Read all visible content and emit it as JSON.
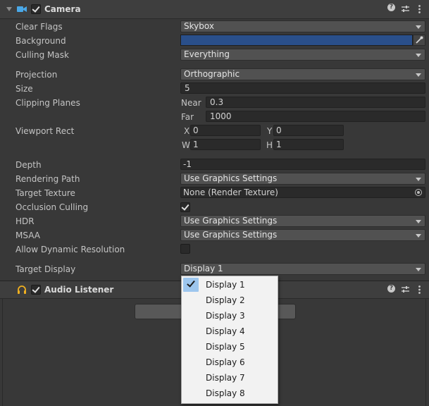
{
  "camera": {
    "title": "Camera",
    "clear_flags": {
      "label": "Clear Flags",
      "value": "Skybox"
    },
    "background": {
      "label": "Background",
      "color": "#2a4f8a"
    },
    "culling_mask": {
      "label": "Culling Mask",
      "value": "Everything"
    },
    "projection": {
      "label": "Projection",
      "value": "Orthographic"
    },
    "size": {
      "label": "Size",
      "value": "5"
    },
    "clipping": {
      "label": "Clipping Planes",
      "near_label": "Near",
      "near": "0.3",
      "far_label": "Far",
      "far": "1000"
    },
    "viewport": {
      "label": "Viewport Rect",
      "x_label": "X",
      "x": "0",
      "y_label": "Y",
      "y": "0",
      "w_label": "W",
      "w": "1",
      "h_label": "H",
      "h": "1"
    },
    "depth": {
      "label": "Depth",
      "value": "-1"
    },
    "rendering_path": {
      "label": "Rendering Path",
      "value": "Use Graphics Settings"
    },
    "target_texture": {
      "label": "Target Texture",
      "value": "None (Render Texture)"
    },
    "occlusion_culling": {
      "label": "Occlusion Culling",
      "checked": true
    },
    "hdr": {
      "label": "HDR",
      "value": "Use Graphics Settings"
    },
    "msaa": {
      "label": "MSAA",
      "value": "Use Graphics Settings"
    },
    "dynamic_resolution": {
      "label": "Allow Dynamic Resolution",
      "checked": false
    },
    "target_display": {
      "label": "Target Display",
      "value": "Display 1"
    }
  },
  "audio_listener": {
    "title": "Audio Listener"
  },
  "display_menu": {
    "items": [
      "Display 1",
      "Display 2",
      "Display 3",
      "Display 4",
      "Display 5",
      "Display 6",
      "Display 7",
      "Display 8"
    ],
    "selected_index": 0
  },
  "header_icons": [
    "help-icon",
    "preset-icon",
    "more-icon"
  ]
}
